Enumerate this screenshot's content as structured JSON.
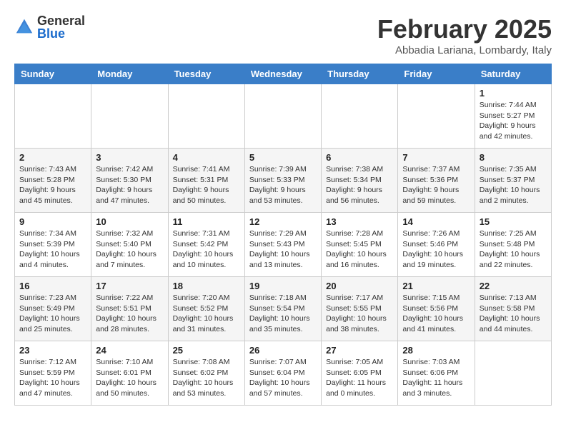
{
  "header": {
    "logo_general": "General",
    "logo_blue": "Blue",
    "month_year": "February 2025",
    "location": "Abbadia Lariana, Lombardy, Italy"
  },
  "weekdays": [
    "Sunday",
    "Monday",
    "Tuesday",
    "Wednesday",
    "Thursday",
    "Friday",
    "Saturday"
  ],
  "weeks": [
    [
      {
        "day": "",
        "info": ""
      },
      {
        "day": "",
        "info": ""
      },
      {
        "day": "",
        "info": ""
      },
      {
        "day": "",
        "info": ""
      },
      {
        "day": "",
        "info": ""
      },
      {
        "day": "",
        "info": ""
      },
      {
        "day": "1",
        "info": "Sunrise: 7:44 AM\nSunset: 5:27 PM\nDaylight: 9 hours and 42 minutes."
      }
    ],
    [
      {
        "day": "2",
        "info": "Sunrise: 7:43 AM\nSunset: 5:28 PM\nDaylight: 9 hours and 45 minutes."
      },
      {
        "day": "3",
        "info": "Sunrise: 7:42 AM\nSunset: 5:30 PM\nDaylight: 9 hours and 47 minutes."
      },
      {
        "day": "4",
        "info": "Sunrise: 7:41 AM\nSunset: 5:31 PM\nDaylight: 9 hours and 50 minutes."
      },
      {
        "day": "5",
        "info": "Sunrise: 7:39 AM\nSunset: 5:33 PM\nDaylight: 9 hours and 53 minutes."
      },
      {
        "day": "6",
        "info": "Sunrise: 7:38 AM\nSunset: 5:34 PM\nDaylight: 9 hours and 56 minutes."
      },
      {
        "day": "7",
        "info": "Sunrise: 7:37 AM\nSunset: 5:36 PM\nDaylight: 9 hours and 59 minutes."
      },
      {
        "day": "8",
        "info": "Sunrise: 7:35 AM\nSunset: 5:37 PM\nDaylight: 10 hours and 2 minutes."
      }
    ],
    [
      {
        "day": "9",
        "info": "Sunrise: 7:34 AM\nSunset: 5:39 PM\nDaylight: 10 hours and 4 minutes."
      },
      {
        "day": "10",
        "info": "Sunrise: 7:32 AM\nSunset: 5:40 PM\nDaylight: 10 hours and 7 minutes."
      },
      {
        "day": "11",
        "info": "Sunrise: 7:31 AM\nSunset: 5:42 PM\nDaylight: 10 hours and 10 minutes."
      },
      {
        "day": "12",
        "info": "Sunrise: 7:29 AM\nSunset: 5:43 PM\nDaylight: 10 hours and 13 minutes."
      },
      {
        "day": "13",
        "info": "Sunrise: 7:28 AM\nSunset: 5:45 PM\nDaylight: 10 hours and 16 minutes."
      },
      {
        "day": "14",
        "info": "Sunrise: 7:26 AM\nSunset: 5:46 PM\nDaylight: 10 hours and 19 minutes."
      },
      {
        "day": "15",
        "info": "Sunrise: 7:25 AM\nSunset: 5:48 PM\nDaylight: 10 hours and 22 minutes."
      }
    ],
    [
      {
        "day": "16",
        "info": "Sunrise: 7:23 AM\nSunset: 5:49 PM\nDaylight: 10 hours and 25 minutes."
      },
      {
        "day": "17",
        "info": "Sunrise: 7:22 AM\nSunset: 5:51 PM\nDaylight: 10 hours and 28 minutes."
      },
      {
        "day": "18",
        "info": "Sunrise: 7:20 AM\nSunset: 5:52 PM\nDaylight: 10 hours and 31 minutes."
      },
      {
        "day": "19",
        "info": "Sunrise: 7:18 AM\nSunset: 5:54 PM\nDaylight: 10 hours and 35 minutes."
      },
      {
        "day": "20",
        "info": "Sunrise: 7:17 AM\nSunset: 5:55 PM\nDaylight: 10 hours and 38 minutes."
      },
      {
        "day": "21",
        "info": "Sunrise: 7:15 AM\nSunset: 5:56 PM\nDaylight: 10 hours and 41 minutes."
      },
      {
        "day": "22",
        "info": "Sunrise: 7:13 AM\nSunset: 5:58 PM\nDaylight: 10 hours and 44 minutes."
      }
    ],
    [
      {
        "day": "23",
        "info": "Sunrise: 7:12 AM\nSunset: 5:59 PM\nDaylight: 10 hours and 47 minutes."
      },
      {
        "day": "24",
        "info": "Sunrise: 7:10 AM\nSunset: 6:01 PM\nDaylight: 10 hours and 50 minutes."
      },
      {
        "day": "25",
        "info": "Sunrise: 7:08 AM\nSunset: 6:02 PM\nDaylight: 10 hours and 53 minutes."
      },
      {
        "day": "26",
        "info": "Sunrise: 7:07 AM\nSunset: 6:04 PM\nDaylight: 10 hours and 57 minutes."
      },
      {
        "day": "27",
        "info": "Sunrise: 7:05 AM\nSunset: 6:05 PM\nDaylight: 11 hours and 0 minutes."
      },
      {
        "day": "28",
        "info": "Sunrise: 7:03 AM\nSunset: 6:06 PM\nDaylight: 11 hours and 3 minutes."
      },
      {
        "day": "",
        "info": ""
      }
    ]
  ]
}
